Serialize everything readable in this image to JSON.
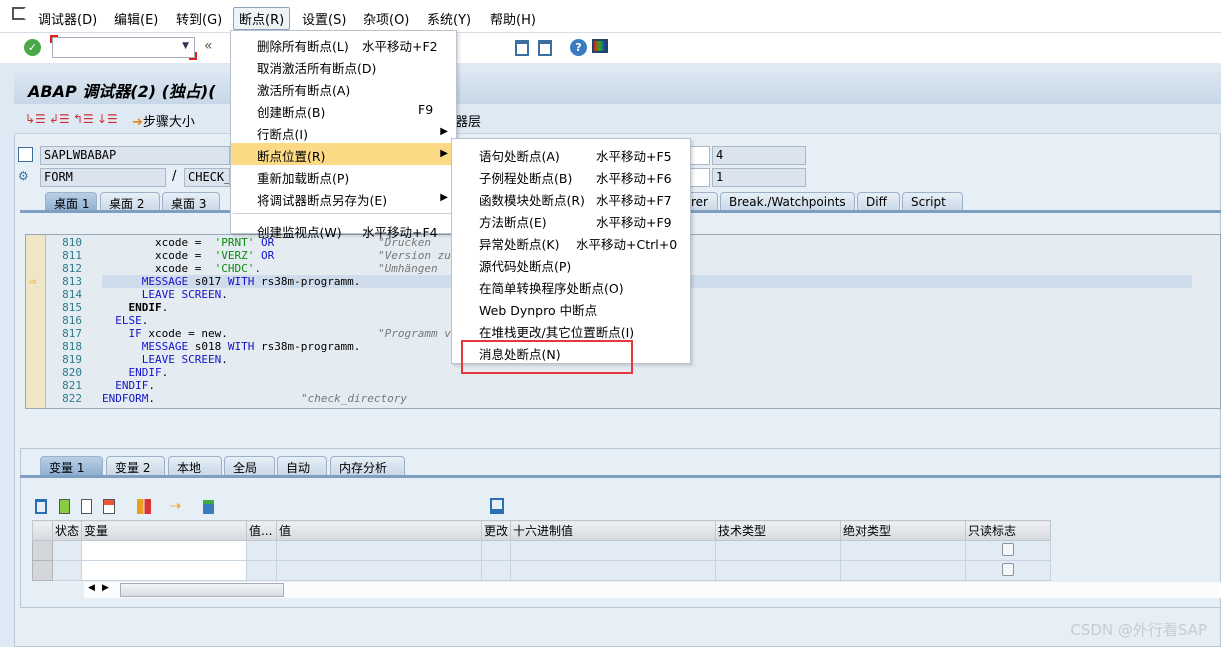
{
  "menubar": {
    "items": [
      "调试器(D)",
      "编辑(E)",
      "转到(G)",
      "断点(R)",
      "设置(S)",
      "杂项(O)",
      "系统(Y)",
      "帮助(H)"
    ],
    "open_index": 3
  },
  "toolbar": {
    "command_value": "",
    "back_symbol": "«"
  },
  "window": {
    "title": "ABAP 调试器(2) (独占)(",
    "step_size_label": "步骤大小",
    "layer_label_fragment": "器层"
  },
  "fields": {
    "program": "SAPLWBABAP",
    "type": "FORM",
    "slash": "/",
    "name": "CHECK_",
    "right_top": "4",
    "right_bottom": "1"
  },
  "desktop_tabs": {
    "items": [
      "桌面 1",
      "桌面 2",
      "桌面 3"
    ],
    "right_items": [
      "rer",
      "Break./Watchpoints",
      "Diff",
      "Script"
    ],
    "active": "桌面 1"
  },
  "code": {
    "current_line": "813",
    "lines": [
      {
        "n": "810",
        "t": "        xcode =  ",
        "s": "'PRNT'",
        "k": " OR",
        "c": "\"Drucken"
      },
      {
        "n": "811",
        "t": "        xcode =  ",
        "s": "'VERZ'",
        "k": " OR",
        "c": "\"Version zu"
      },
      {
        "n": "812",
        "t": "        xcode =  ",
        "s": "'CHDC'",
        "k": ".",
        "c": "\"Umhängen"
      },
      {
        "n": "813",
        "t": "      ",
        "k2": "MESSAGE",
        "t2": " s017 ",
        "k3": "WITH",
        "t3": " rs38m-programm."
      },
      {
        "n": "814",
        "t": "      ",
        "k2": "LEAVE SCREEN",
        "t2": "."
      },
      {
        "n": "815",
        "t": "    ",
        "b": "ENDIF",
        "t2": "."
      },
      {
        "n": "816",
        "t": "  ",
        "k2": "ELSE",
        "t2": "."
      },
      {
        "n": "817",
        "t": "    ",
        "k2": "IF",
        "t2": " xcode = new.",
        "c": "\"Programm v"
      },
      {
        "n": "818",
        "t": "      ",
        "k2": "MESSAGE",
        "t2": " s018 ",
        "k3": "WITH",
        "t3": " rs38m-programm."
      },
      {
        "n": "819",
        "t": "      ",
        "k2": "LEAVE SCREEN",
        "t2": "."
      },
      {
        "n": "820",
        "t": "    ",
        "k2": "ENDIF",
        "t2": "."
      },
      {
        "n": "821",
        "t": "  ",
        "k2": "ENDIF",
        "t2": "."
      },
      {
        "n": "822",
        "t": "",
        "k2": "ENDFORM",
        "t2": ".",
        "c": "\"check_directory"
      }
    ]
  },
  "var_tabs": {
    "items": [
      "变量 1",
      "变量 2",
      "本地",
      "全局",
      "自动",
      "内存分析"
    ],
    "active": "变量 1"
  },
  "var_table": {
    "columns": [
      "状态",
      "变量",
      "值...",
      "值",
      "更改",
      "十六进制值",
      "技术类型",
      "绝对类型",
      "只读标志"
    ],
    "row_count": 2
  },
  "breakpoint_menu": {
    "items": [
      {
        "label": "删除所有断点(L)",
        "shortcut": "水平移动+F2"
      },
      {
        "label": "取消激活所有断点(D)",
        "shortcut": ""
      },
      {
        "label": "激活所有断点(A)",
        "shortcut": ""
      },
      {
        "label": "创建断点(B)",
        "shortcut": "F9"
      },
      {
        "label": "行断点(I)",
        "shortcut": "",
        "submenu": true
      },
      {
        "label": "断点位置(R)",
        "shortcut": "",
        "submenu": true,
        "highlighted": true
      },
      {
        "label": "重新加载断点(P)",
        "shortcut": ""
      },
      {
        "label": "将调试器断点另存为(E)",
        "shortcut": "",
        "submenu": true
      },
      {
        "label": "创建监视点(W)",
        "shortcut": "水平移动+F4"
      }
    ]
  },
  "location_submenu": {
    "items": [
      {
        "label": "语句处断点(A)",
        "shortcut": "水平移动+F5"
      },
      {
        "label": "子例程处断点(B)",
        "shortcut": "水平移动+F6"
      },
      {
        "label": "函数模块处断点(R)",
        "shortcut": "水平移动+F7"
      },
      {
        "label": "方法断点(E)",
        "shortcut": "水平移动+F9"
      },
      {
        "label": "异常处断点(K)",
        "shortcut": "水平移动+Ctrl+0"
      },
      {
        "label": "源代码处断点(P)",
        "shortcut": ""
      },
      {
        "label": "在简单转换程序处断点(O)",
        "shortcut": ""
      },
      {
        "label": "Web Dynpro 中断点",
        "shortcut": ""
      },
      {
        "label": "在堆栈更改/其它位置断点(I)",
        "shortcut": ""
      },
      {
        "label": "消息处断点(N)",
        "shortcut": "",
        "annotated": true
      }
    ]
  },
  "annotation_color": "#e8383c",
  "highlight_color": "#fbd985",
  "watermark": "CSDN @外行看SAP"
}
